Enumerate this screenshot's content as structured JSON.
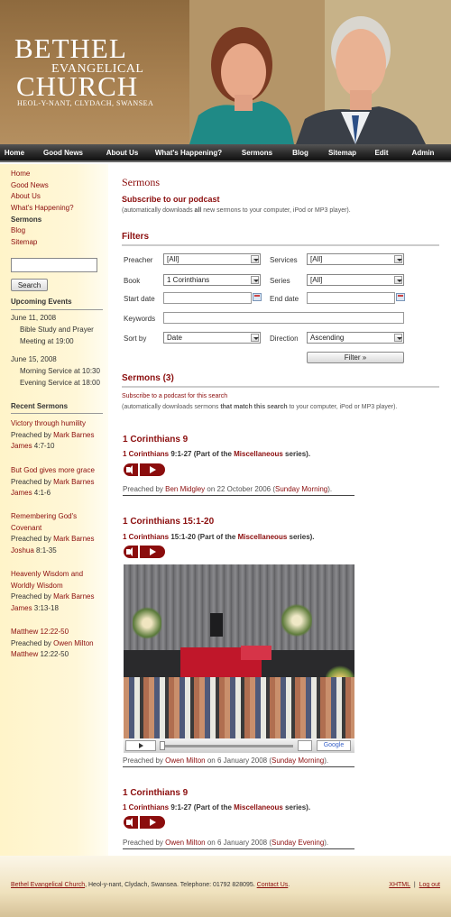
{
  "header": {
    "logo_line1": "BETHEL",
    "logo_line2": "EVANGELICAL",
    "logo_line3": "CHURCH",
    "logo_line4": "HEOL-Y-NANT, CLYDACH, SWANSEA"
  },
  "nav": [
    "Home",
    "Good News",
    "About Us",
    "What's Happening?",
    "Sermons",
    "Blog",
    "Sitemap",
    "Edit",
    "Admin"
  ],
  "sidebar": {
    "menu": [
      "Home",
      "Good News",
      "About Us",
      "What's Happening?",
      "Sermons",
      "Blog",
      "Sitemap"
    ],
    "active": "Sermons",
    "search_button": "Search",
    "upcoming_heading": "Upcoming Events",
    "events": [
      {
        "date": "June 11, 2008",
        "lines": [
          "Bible Study and Prayer",
          "Meeting at 19:00"
        ]
      },
      {
        "date": "June 15, 2008",
        "lines": [
          "Morning Service at 10:30",
          "Evening Service at 18:00"
        ]
      }
    ],
    "recent_heading": "Recent Sermons",
    "recent": [
      {
        "title": [
          "Victory through humility"
        ],
        "by_prefix": "Preached by ",
        "by": "Mark Barnes",
        "book": "James",
        "ref": " 4:7-10"
      },
      {
        "title": [
          "But God gives more grace"
        ],
        "by_prefix": "Preached by ",
        "by": "Mark Barnes",
        "book": "James",
        "ref": " 4:1-6"
      },
      {
        "title": [
          "Remembering God's",
          "Covenant"
        ],
        "by_prefix": "Preached by ",
        "by": "Mark Barnes",
        "book": "Joshua",
        "ref": " 8:1-35"
      },
      {
        "title": [
          "Heavenly Wisdom and",
          "Worldly Wisdom"
        ],
        "by_prefix": "Preached by ",
        "by": "Mark Barnes",
        "book": "James",
        "ref": " 3:13-18"
      },
      {
        "title": [
          "Matthew 12:22-50"
        ],
        "by_prefix": "Preached by ",
        "by": "Owen Milton",
        "book": "Matthew",
        "ref": " 12:22-50"
      }
    ]
  },
  "main": {
    "page_title": "Sermons",
    "podcast_heading": "Subscribe to our podcast",
    "podcast_note_pre": "(automatically downloads ",
    "podcast_note_bold": "all",
    "podcast_note_post": " new sermons to your computer, iPod or MP3 player).",
    "filters_heading": "Filters",
    "filters": {
      "preacher_label": "Preacher",
      "preacher_value": "[All]",
      "services_label": "Services",
      "services_value": "[All]",
      "book_label": "Book",
      "book_value": "1 Corinthians",
      "series_label": "Series",
      "series_value": "[All]",
      "start_label": "Start date",
      "end_label": "End date",
      "keywords_label": "Keywords",
      "sort_label": "Sort by",
      "sort_value": "Date",
      "direction_label": "Direction",
      "direction_value": "Ascending",
      "filter_button": "Filter »"
    },
    "sermons_heading": "Sermons (3)",
    "search_podcast_link": "Subscribe to a podcast for this search",
    "search_podcast_note_pre": "(automatically downloads sermons ",
    "search_podcast_note_bold": "that match this search",
    "search_podcast_note_post": " to your computer, iPod or MP3 player).",
    "sermons": [
      {
        "title": "1 Corinthians 9",
        "book": "1 Corinthians",
        "ref": " 9:1-27 (Part of the ",
        "series": "Miscellaneous",
        "series_post": " series).",
        "by_prefix": "Preached by ",
        "preacher": "Ben Midgley",
        "date": " on 22 October 2006 (",
        "service": "Sunday Morning",
        "tail": ")."
      },
      {
        "title": "1 Corinthians 15:1-20",
        "book": "1 Corinthians",
        "ref": " 15:1-20 (Part of the ",
        "series": "Miscellaneous",
        "series_post": " series).",
        "by_prefix": "Preached by ",
        "preacher": "Owen Milton",
        "date": " on 6 January 2008 (",
        "service": "Sunday Morning",
        "tail": ")."
      },
      {
        "title": "1 Corinthians 9",
        "book": "1 Corinthians",
        "ref": " 9:1-27 (Part of the ",
        "series": "Miscellaneous",
        "series_post": " series).",
        "by_prefix": "Preached by ",
        "preacher": "Owen Milton",
        "date": " on 6 January 2008 (",
        "service": "Sunday Evening",
        "tail": ")."
      }
    ],
    "video_brand": "Google"
  },
  "footer": {
    "church": "Bethel Evangelical Church",
    "address": ", Heol-y-nant, Clydach, Swansea. Telephone: 01792 828095. ",
    "contact": "Contact Us",
    "period": ".",
    "xhtml": "XHTML",
    "logout": "Log out"
  }
}
